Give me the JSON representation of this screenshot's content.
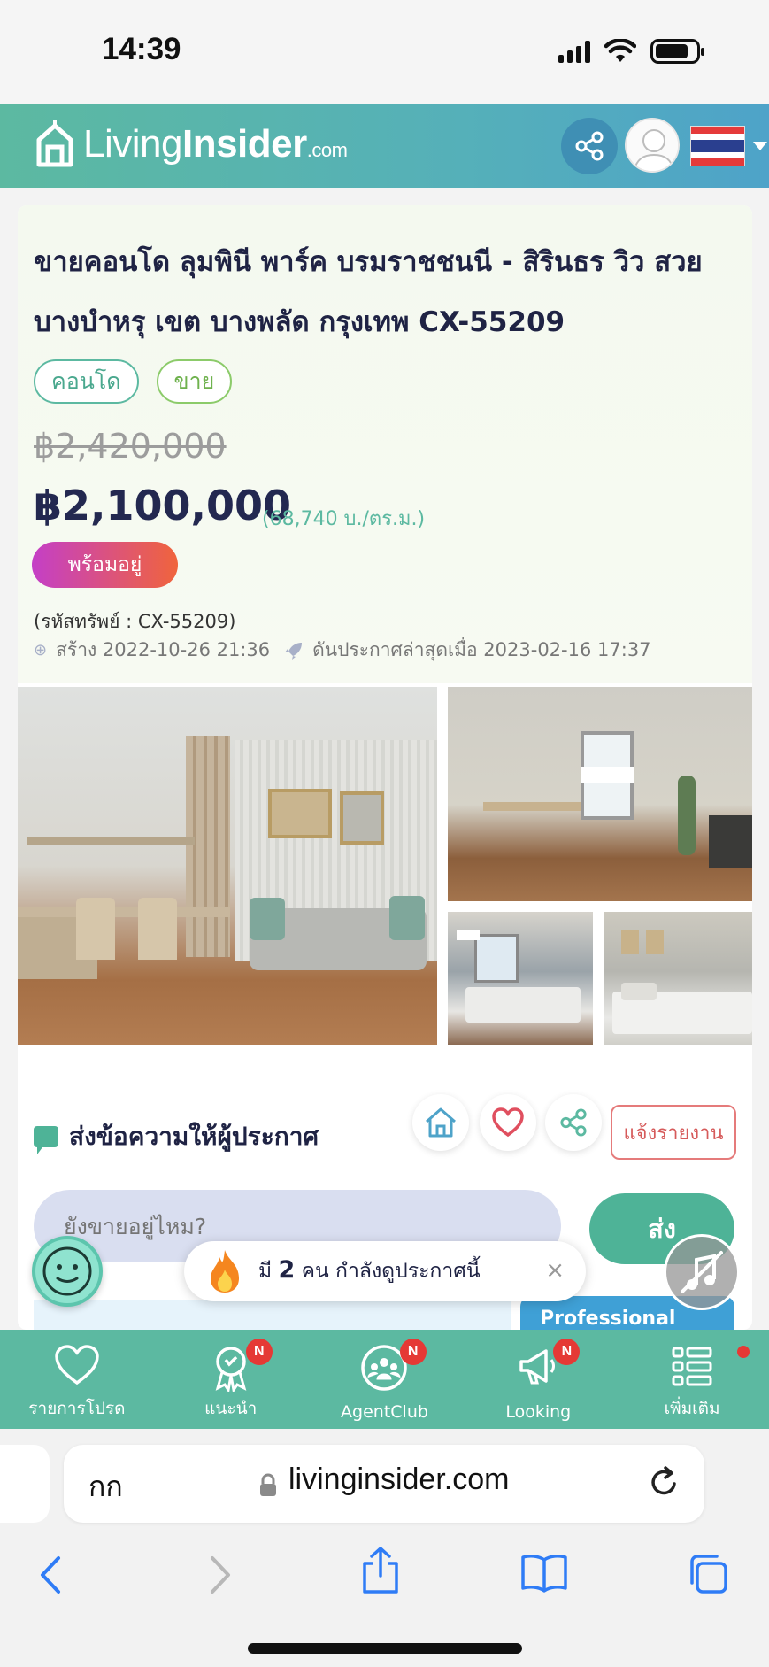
{
  "status_bar": {
    "time": "14:39"
  },
  "header": {
    "logo_part1": "Living",
    "logo_part2": "Insider",
    "logo_part3": ".com"
  },
  "listing": {
    "title": "ขายคอนโด ลุมพินี พาร์ค บรมราชชนนี - สิรินธร วิว สวย บางบำหรุ เขต บางพลัด กรุงเทพ CX-55209",
    "tags": [
      "คอนโด",
      "ขาย"
    ],
    "old_price": "฿2,420,000",
    "price": "฿2,100,000",
    "price_per_sqm": "(68,740 บ./ตร.ม.)",
    "status_badge": "พร้อมอยู่",
    "property_code": "(รหัสทรัพย์ : CX-55209)",
    "created": "สร้าง 2022-10-26 21:36",
    "last_boosted": "ดันประกาศล่าสุดเมื่อ 2023-02-16 17:37"
  },
  "contact": {
    "section_title": "ส่งข้อความให้ผู้ประกาศ",
    "report_label": "แจ้งรายงาน",
    "message_placeholder": "ยังขายอยู่ไหม?",
    "send_label": "ส่ง",
    "professional_label": "Professional"
  },
  "toast": {
    "prefix": "มี",
    "count": "2",
    "suffix": "คน กำลังดูประกาศนี้",
    "close": "×"
  },
  "bottom_nav": [
    {
      "label": "รายการโปรด",
      "icon": "heart-icon",
      "badge": ""
    },
    {
      "label": "แนะนำ",
      "icon": "award-ribbon-icon",
      "badge": "N"
    },
    {
      "label": "AgentClub",
      "icon": "group-icon",
      "badge": "N"
    },
    {
      "label": "Looking",
      "icon": "megaphone-icon",
      "badge": "N"
    },
    {
      "label": "เพิ่มเติม",
      "icon": "list-grid-icon",
      "badge": ""
    }
  ],
  "browser": {
    "text_size_label": "กก",
    "url": "livinginsider.com"
  },
  "colors": {
    "brand_green": "#5cb9a1",
    "brand_blue": "#4ea3c9",
    "price_navy": "#232850",
    "badge_red": "#e53935"
  }
}
